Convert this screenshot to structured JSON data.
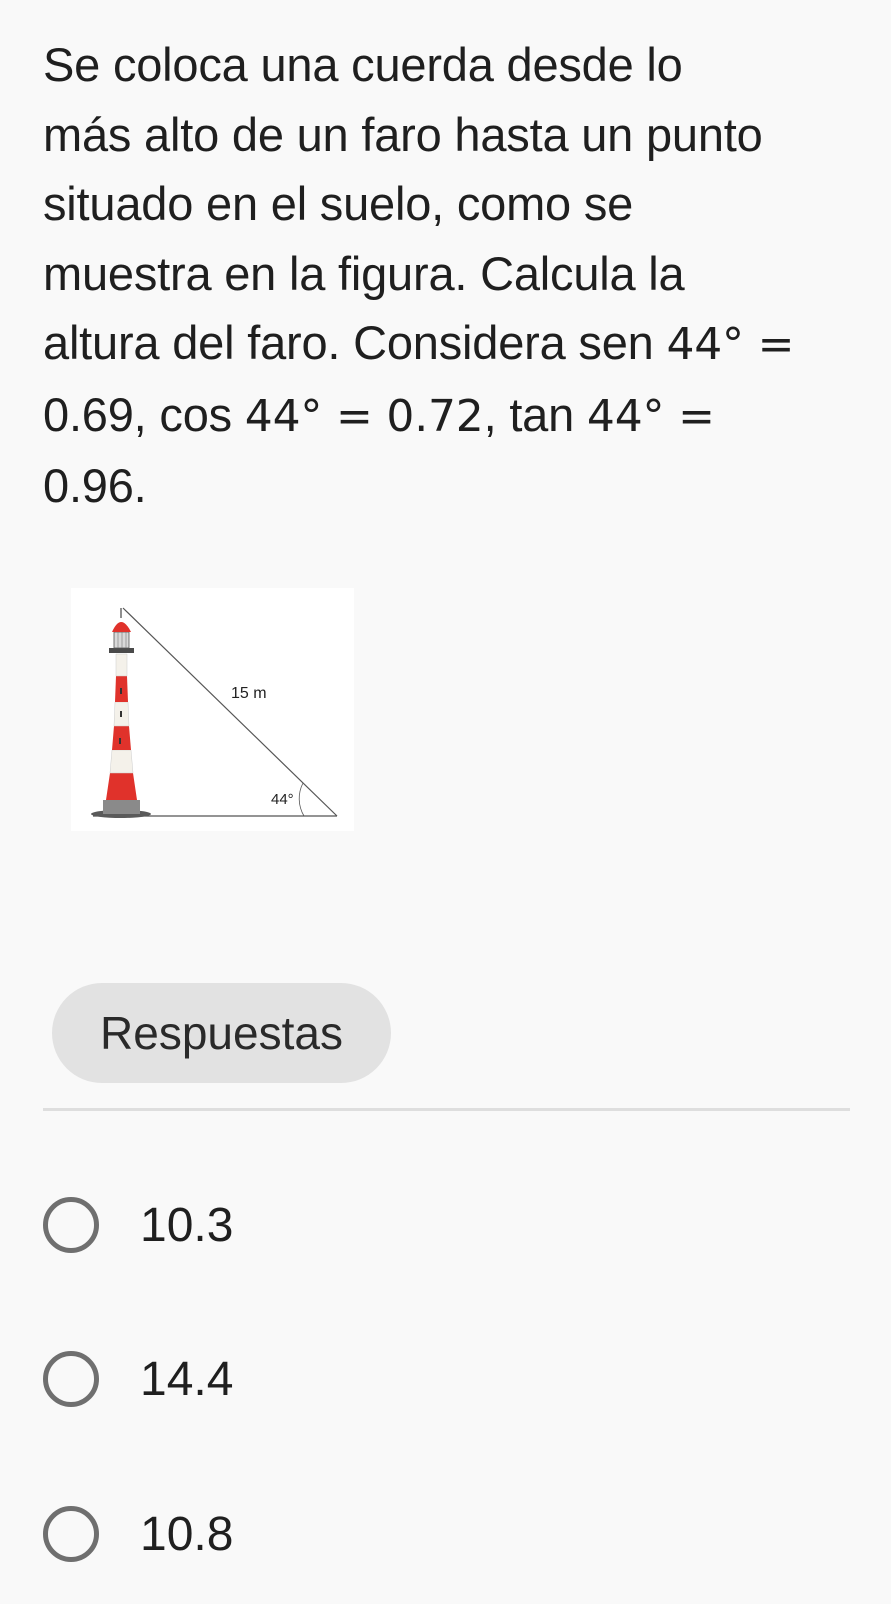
{
  "question": {
    "line1": "Se coloca una cuerda desde lo",
    "line2": "más alto de un faro hasta un punto",
    "line3": "situado en el suelo, como se",
    "line4": "muestra en la figura. Calcula la",
    "line5_text": "altura del faro. Considera sen ",
    "line5_math": "44° =",
    "line6_a": "0.69, cos ",
    "line6_math1": "44° = 0.72",
    "line6_b": ", tan ",
    "line6_math2": "44° =",
    "line7": "0.96."
  },
  "figure": {
    "hypotenuse_label": "15 m",
    "angle_label": "44°",
    "colors": {
      "red": "#e0322b",
      "white": "#f4f1ea",
      "dark": "#3a3a3a"
    }
  },
  "answers": {
    "chip_label": "Respuestas",
    "options": [
      {
        "label": "10.3",
        "selected": false
      },
      {
        "label": "14.4",
        "selected": false
      },
      {
        "label": "10.8",
        "selected": false
      }
    ]
  }
}
